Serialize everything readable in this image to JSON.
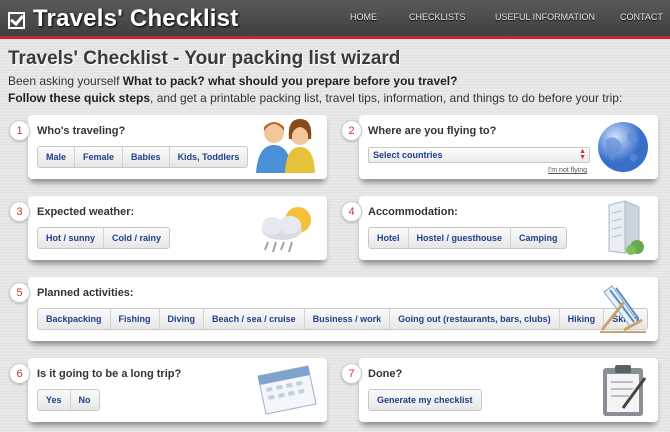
{
  "header": {
    "logo_text": "Travels' Checklist",
    "nav": [
      "HOME",
      "CHECKLISTS",
      "USEFUL INFORMATION",
      "CONTACT"
    ]
  },
  "intro": {
    "title": "Travels' Checklist - Your packing list wizard",
    "line1_prefix": "Been asking yourself ",
    "line1_bold": "What to pack? what should you prepare before you travel?",
    "line2_bold": "Follow these quick steps",
    "line2_rest": ", and get a printable packing list, travel tips, information, and things to do before your trip:"
  },
  "steps": {
    "s1": {
      "num": "1",
      "title": "Who's traveling?",
      "options": [
        "Male",
        "Female",
        "Babies",
        "Kids, Toddlers"
      ],
      "icon": "people-icon"
    },
    "s2": {
      "num": "2",
      "title": "Where are you flying to?",
      "select_value": "Select countries",
      "not_flying": "I'm not flying",
      "icon": "globe-icon"
    },
    "s3": {
      "num": "3",
      "title": "Expected weather:",
      "options": [
        "Hot / sunny",
        "Cold / rainy"
      ],
      "icon": "weather-icon"
    },
    "s4": {
      "num": "4",
      "title": "Accommodation:",
      "options": [
        "Hotel",
        "Hostel / guesthouse",
        "Camping"
      ],
      "icon": "building-icon"
    },
    "s5": {
      "num": "5",
      "title": "Planned activities:",
      "options": [
        "Backpacking",
        "Fishing",
        "Diving",
        "Beach / sea / cruise",
        "Business / work",
        "Going out (restaurants, bars, clubs)",
        "Hiking",
        "Skiing"
      ],
      "icon": "beach-chair-icon"
    },
    "s6": {
      "num": "6",
      "title": "Is it going to be a long trip?",
      "options": [
        "Yes",
        "No"
      ],
      "icon": "calendar-icon"
    },
    "s7": {
      "num": "7",
      "title": "Done?",
      "button": "Generate my checklist",
      "icon": "clipboard-icon"
    }
  },
  "colors": {
    "accent_red": "#c0283a",
    "link_blue": "#1e3f8a",
    "header_bg": "#4a4a4a"
  }
}
